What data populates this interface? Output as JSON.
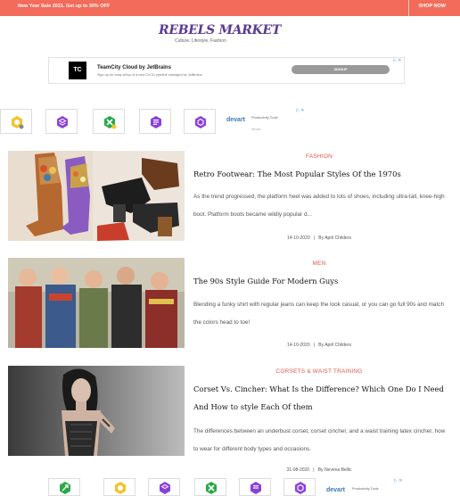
{
  "topbar": {
    "promo": "New Year Sale 2021. Get up to 30% OFF",
    "shop_now": "SHOP NOW",
    "color": "#f26b5b"
  },
  "site": {
    "logo": "REBELS MARKET",
    "tagline": "Culture. Lifestyle. Fashion"
  },
  "ad_banner": {
    "logo_text": "TC",
    "title": "TeamCity Cloud by JetBrains",
    "subtitle": "Sign up for easy setup of a new CI/CD pipeline managed by JetBrains",
    "cta": "SIGNUP",
    "adchoice": "▷ ✕"
  },
  "ad_tiles": {
    "icons": [
      "config-icon",
      "layers-icon",
      "cross-cart-icon",
      "document-stack-icon",
      "hex-d-icon"
    ],
    "brand": "devart",
    "brand_caption": "Productivity Tools",
    "brand_sub": "devart",
    "adchoice": "▷ ✕"
  },
  "articles": [
    {
      "category": "FASHION",
      "title": "Retro Footwear: The Most Popular Styles Of the 1970s",
      "excerpt": "As the trend progressed, the platform heel was added to lots of shoes, including ultra-tall, knee-high boot. Platform boots became wildly popular d...",
      "date": "14-10-2020",
      "author": "By April Childers"
    },
    {
      "category": "MEN",
      "title": "The 90s Style Guide For Modern Guys",
      "excerpt": "Blending a funky shirt with regular jeans can keep the look casual, or you can go full 90s and match the colors head to toe!",
      "date": "14-10-2020",
      "author": "By April Childers"
    },
    {
      "category": "CORSETS & WAIST TRAINING",
      "title": "Corset Vs. Cincher: What Is the Difference? Which One Do I Need And How to style Each Of them",
      "excerpt": "The differences between an underbust corset, corset cincher, and a waist training latex cincher, how to wear for different body types and occasions.",
      "date": "31-08-2020",
      "author": "By Nevena Bellic"
    }
  ],
  "meta_separator": "|",
  "bottom_ad": {
    "icons": [
      "refresh-arrow-icon",
      "config-icon",
      "layers-icon",
      "cross-cart-icon",
      "document-stack-icon",
      "hex-d-icon"
    ],
    "brand": "devart",
    "brand_caption": "Productivity Tools",
    "adchoice": "▷ ✕"
  }
}
